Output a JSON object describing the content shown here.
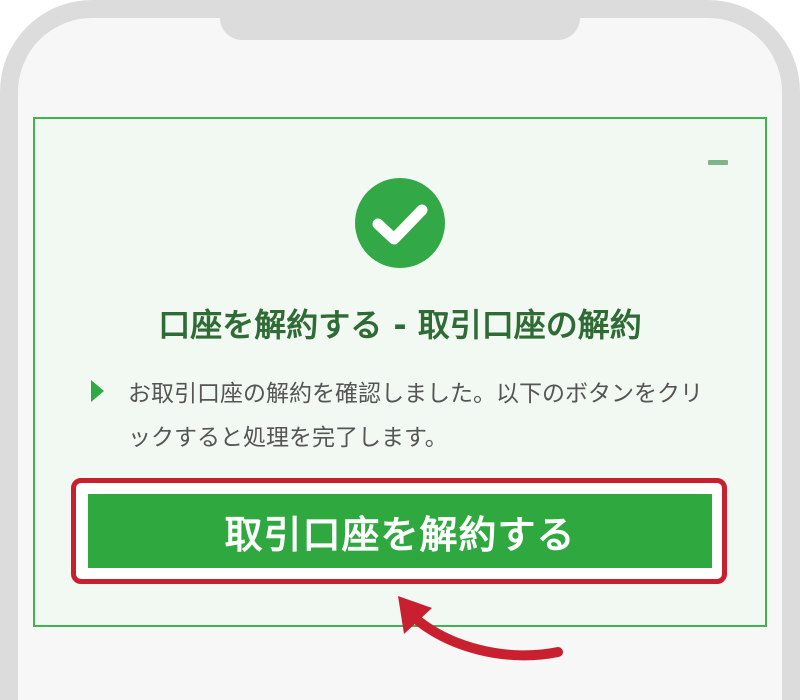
{
  "dialog": {
    "title": "口座を解約する - 取引口座の解約",
    "message": "お取引口座の解約を確認しました。以下のボタンをクリックすると処理を完了します。",
    "button_label": "取引口座を解約する",
    "minimize_icon": "minimize-icon",
    "status_icon": "check-circle-icon"
  },
  "annotation": {
    "arrow_icon": "curved-arrow-icon",
    "highlight_color": "#c8202e"
  },
  "colors": {
    "accent_green": "#2ea83f",
    "title_green": "#2f6b35",
    "card_background": "#f2f9f2"
  }
}
